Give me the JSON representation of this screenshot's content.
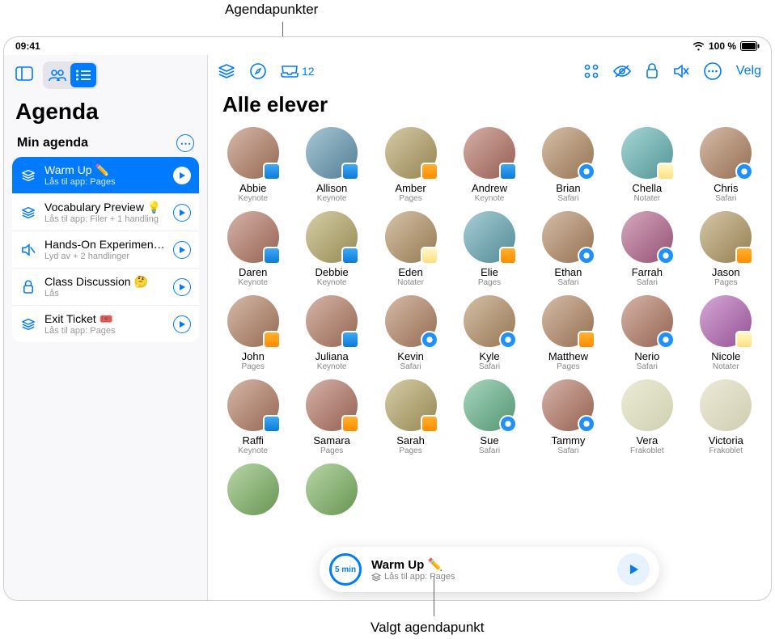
{
  "callouts": {
    "top": "Agendapunkter",
    "bottom": "Valgt agendapunkt"
  },
  "status": {
    "time": "09:41",
    "battery": "100 %"
  },
  "sidebar": {
    "title": "Agenda",
    "section": "Min agenda",
    "items": [
      {
        "icon": "layers",
        "title": "Warm Up ✏️",
        "sub": "Lås til app: Pages",
        "selected": true
      },
      {
        "icon": "layers",
        "title": "Vocabulary Preview 💡",
        "sub": "Lås til app: Filer + 1 handling",
        "selected": false
      },
      {
        "icon": "mute",
        "title": "Hands-On Experiment 🧪",
        "sub": "Lyd av + 2 handlinger",
        "selected": false
      },
      {
        "icon": "lock",
        "title": "Class Discussion 🤔",
        "sub": "Lås",
        "selected": false
      },
      {
        "icon": "layers",
        "title": "Exit Ticket 🎟️",
        "sub": "Lås til app: Pages",
        "selected": false
      }
    ]
  },
  "main": {
    "title": "Alle elever",
    "inbox_count": "12",
    "select_label": "Velg",
    "students": [
      {
        "name": "Abbie",
        "app": "Keynote",
        "badge": "keynote"
      },
      {
        "name": "Allison",
        "app": "Keynote",
        "badge": "keynote"
      },
      {
        "name": "Amber",
        "app": "Pages",
        "badge": "pages"
      },
      {
        "name": "Andrew",
        "app": "Keynote",
        "badge": "keynote"
      },
      {
        "name": "Brian",
        "app": "Safari",
        "badge": "safari"
      },
      {
        "name": "Chella",
        "app": "Notater",
        "badge": "notes"
      },
      {
        "name": "Chris",
        "app": "Safari",
        "badge": "safari"
      },
      {
        "name": "Daren",
        "app": "Keynote",
        "badge": "keynote"
      },
      {
        "name": "Debbie",
        "app": "Keynote",
        "badge": "keynote"
      },
      {
        "name": "Eden",
        "app": "Notater",
        "badge": "notes"
      },
      {
        "name": "Elie",
        "app": "Pages",
        "badge": "pages"
      },
      {
        "name": "Ethan",
        "app": "Safari",
        "badge": "safari"
      },
      {
        "name": "Farrah",
        "app": "Safari",
        "badge": "safari"
      },
      {
        "name": "Jason",
        "app": "Pages",
        "badge": "pages"
      },
      {
        "name": "John",
        "app": "Pages",
        "badge": "pages"
      },
      {
        "name": "Juliana",
        "app": "Keynote",
        "badge": "keynote"
      },
      {
        "name": "Kevin",
        "app": "Safari",
        "badge": "safari"
      },
      {
        "name": "Kyle",
        "app": "Safari",
        "badge": "safari"
      },
      {
        "name": "Matthew",
        "app": "Pages",
        "badge": "pages"
      },
      {
        "name": "Nerio",
        "app": "Safari",
        "badge": "safari"
      },
      {
        "name": "Nicole",
        "app": "Notater",
        "badge": "notes"
      },
      {
        "name": "Raffi",
        "app": "Keynote",
        "badge": "keynote"
      },
      {
        "name": "Samara",
        "app": "Pages",
        "badge": "pages"
      },
      {
        "name": "Sarah",
        "app": "Pages",
        "badge": "pages"
      },
      {
        "name": "Sue",
        "app": "Safari",
        "badge": "safari"
      },
      {
        "name": "Tammy",
        "app": "Safari",
        "badge": "safari"
      },
      {
        "name": "Vera",
        "app": "Frakoblet",
        "badge": "",
        "offline": true
      },
      {
        "name": "Victoria",
        "app": "Frakoblet",
        "badge": "",
        "offline": true
      },
      {
        "name": "",
        "app": "",
        "badge": ""
      },
      {
        "name": "",
        "app": "",
        "badge": ""
      }
    ]
  },
  "player": {
    "timer": "5 min",
    "title": "Warm Up ✏️",
    "sub": "Lås til app: Pages"
  },
  "avatar_hues": [
    20,
    200,
    45,
    10,
    30,
    180,
    25,
    15,
    50,
    35,
    190,
    28,
    330,
    40,
    22,
    18,
    24,
    32,
    26,
    16,
    300,
    19,
    12,
    48,
    150,
    14,
    60,
    55,
    100,
    100
  ]
}
